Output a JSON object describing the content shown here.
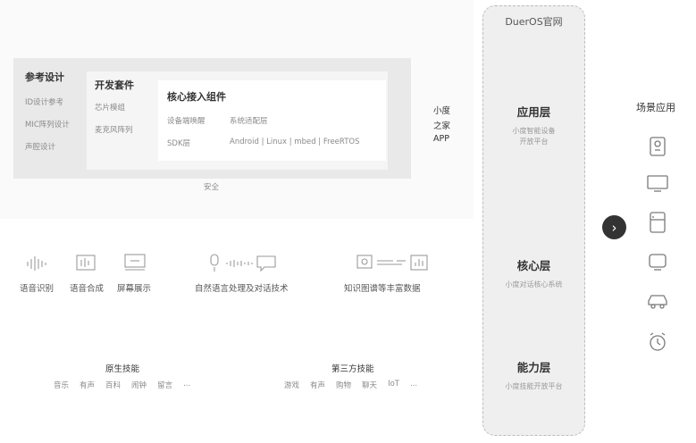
{
  "reference_design": {
    "title": "参考设计",
    "items": [
      "ID设计参考",
      "MIC阵列设计",
      "声腔设计"
    ]
  },
  "dev_kit": {
    "title": "开发套件",
    "items": [
      "芯片模组",
      "麦克风阵列"
    ]
  },
  "core_components": {
    "title": "核心接入组件",
    "rows": [
      {
        "label": "设备端唤醒",
        "value": "系统适配层"
      },
      {
        "label": "SDK层",
        "value": "Android | Linux | mbed | FreeRTOS"
      }
    ]
  },
  "security_label": "安全",
  "xiaodu_app": [
    "小度",
    "之家",
    "APP"
  ],
  "capabilities": [
    {
      "label": "语音识别",
      "icon": "waveform-icon"
    },
    {
      "label": "语音合成",
      "icon": "speech-synthesis-icon"
    },
    {
      "label": "屏幕展示",
      "icon": "screen-icon"
    },
    {
      "label": "自然语言处理及对话技术",
      "icon": "mic-dialog-icon"
    },
    {
      "label": "知识图谱等丰富数据",
      "icon": "knowledge-graph-icon"
    }
  ],
  "native_skills": {
    "title": "原生技能",
    "items": [
      "音乐",
      "有声",
      "百科",
      "闹钟",
      "留言",
      "..."
    ]
  },
  "third_party_skills": {
    "title": "第三方技能",
    "items": [
      "游戏",
      "有声",
      "购物",
      "聊天",
      "IoT",
      "..."
    ]
  },
  "dueros": {
    "title": "DuerOS官网",
    "layers": [
      {
        "name": "应用层",
        "sub1": "小度智能设备",
        "sub2": "开放平台"
      },
      {
        "name": "核心层",
        "sub1": "小度对话核心系统",
        "sub2": ""
      },
      {
        "name": "能力层",
        "sub1": "小度技能开放平台",
        "sub2": ""
      }
    ]
  },
  "scenes": {
    "title": "场景应用",
    "devices": [
      "speaker-icon",
      "tv-icon",
      "fridge-icon",
      "tv-box-icon",
      "car-icon",
      "alarm-clock-icon"
    ]
  },
  "colors": {
    "accent": "#333333",
    "panel": "#e9e9e9",
    "text_muted": "#8a8a8a"
  }
}
